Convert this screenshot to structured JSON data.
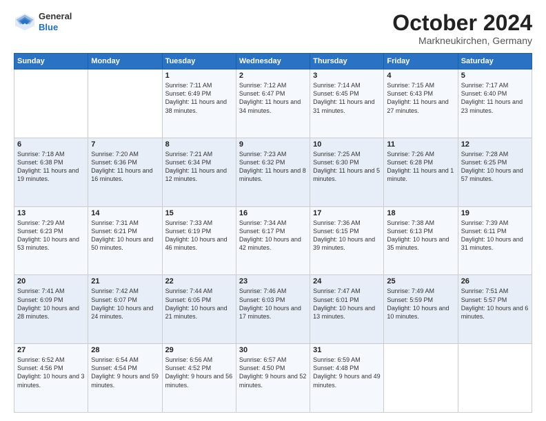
{
  "header": {
    "logo": {
      "general": "General",
      "blue": "Blue"
    },
    "title": "October 2024",
    "location": "Markneukirchen, Germany"
  },
  "weekdays": [
    "Sunday",
    "Monday",
    "Tuesday",
    "Wednesday",
    "Thursday",
    "Friday",
    "Saturday"
  ],
  "weeks": [
    [
      {
        "day": "",
        "info": ""
      },
      {
        "day": "",
        "info": ""
      },
      {
        "day": "1",
        "info": "Sunrise: 7:11 AM\nSunset: 6:49 PM\nDaylight: 11 hours and 38 minutes."
      },
      {
        "day": "2",
        "info": "Sunrise: 7:12 AM\nSunset: 6:47 PM\nDaylight: 11 hours and 34 minutes."
      },
      {
        "day": "3",
        "info": "Sunrise: 7:14 AM\nSunset: 6:45 PM\nDaylight: 11 hours and 31 minutes."
      },
      {
        "day": "4",
        "info": "Sunrise: 7:15 AM\nSunset: 6:43 PM\nDaylight: 11 hours and 27 minutes."
      },
      {
        "day": "5",
        "info": "Sunrise: 7:17 AM\nSunset: 6:40 PM\nDaylight: 11 hours and 23 minutes."
      }
    ],
    [
      {
        "day": "6",
        "info": "Sunrise: 7:18 AM\nSunset: 6:38 PM\nDaylight: 11 hours and 19 minutes."
      },
      {
        "day": "7",
        "info": "Sunrise: 7:20 AM\nSunset: 6:36 PM\nDaylight: 11 hours and 16 minutes."
      },
      {
        "day": "8",
        "info": "Sunrise: 7:21 AM\nSunset: 6:34 PM\nDaylight: 11 hours and 12 minutes."
      },
      {
        "day": "9",
        "info": "Sunrise: 7:23 AM\nSunset: 6:32 PM\nDaylight: 11 hours and 8 minutes."
      },
      {
        "day": "10",
        "info": "Sunrise: 7:25 AM\nSunset: 6:30 PM\nDaylight: 11 hours and 5 minutes."
      },
      {
        "day": "11",
        "info": "Sunrise: 7:26 AM\nSunset: 6:28 PM\nDaylight: 11 hours and 1 minute."
      },
      {
        "day": "12",
        "info": "Sunrise: 7:28 AM\nSunset: 6:25 PM\nDaylight: 10 hours and 57 minutes."
      }
    ],
    [
      {
        "day": "13",
        "info": "Sunrise: 7:29 AM\nSunset: 6:23 PM\nDaylight: 10 hours and 53 minutes."
      },
      {
        "day": "14",
        "info": "Sunrise: 7:31 AM\nSunset: 6:21 PM\nDaylight: 10 hours and 50 minutes."
      },
      {
        "day": "15",
        "info": "Sunrise: 7:33 AM\nSunset: 6:19 PM\nDaylight: 10 hours and 46 minutes."
      },
      {
        "day": "16",
        "info": "Sunrise: 7:34 AM\nSunset: 6:17 PM\nDaylight: 10 hours and 42 minutes."
      },
      {
        "day": "17",
        "info": "Sunrise: 7:36 AM\nSunset: 6:15 PM\nDaylight: 10 hours and 39 minutes."
      },
      {
        "day": "18",
        "info": "Sunrise: 7:38 AM\nSunset: 6:13 PM\nDaylight: 10 hours and 35 minutes."
      },
      {
        "day": "19",
        "info": "Sunrise: 7:39 AM\nSunset: 6:11 PM\nDaylight: 10 hours and 31 minutes."
      }
    ],
    [
      {
        "day": "20",
        "info": "Sunrise: 7:41 AM\nSunset: 6:09 PM\nDaylight: 10 hours and 28 minutes."
      },
      {
        "day": "21",
        "info": "Sunrise: 7:42 AM\nSunset: 6:07 PM\nDaylight: 10 hours and 24 minutes."
      },
      {
        "day": "22",
        "info": "Sunrise: 7:44 AM\nSunset: 6:05 PM\nDaylight: 10 hours and 21 minutes."
      },
      {
        "day": "23",
        "info": "Sunrise: 7:46 AM\nSunset: 6:03 PM\nDaylight: 10 hours and 17 minutes."
      },
      {
        "day": "24",
        "info": "Sunrise: 7:47 AM\nSunset: 6:01 PM\nDaylight: 10 hours and 13 minutes."
      },
      {
        "day": "25",
        "info": "Sunrise: 7:49 AM\nSunset: 5:59 PM\nDaylight: 10 hours and 10 minutes."
      },
      {
        "day": "26",
        "info": "Sunrise: 7:51 AM\nSunset: 5:57 PM\nDaylight: 10 hours and 6 minutes."
      }
    ],
    [
      {
        "day": "27",
        "info": "Sunrise: 6:52 AM\nSunset: 4:56 PM\nDaylight: 10 hours and 3 minutes."
      },
      {
        "day": "28",
        "info": "Sunrise: 6:54 AM\nSunset: 4:54 PM\nDaylight: 9 hours and 59 minutes."
      },
      {
        "day": "29",
        "info": "Sunrise: 6:56 AM\nSunset: 4:52 PM\nDaylight: 9 hours and 56 minutes."
      },
      {
        "day": "30",
        "info": "Sunrise: 6:57 AM\nSunset: 4:50 PM\nDaylight: 9 hours and 52 minutes."
      },
      {
        "day": "31",
        "info": "Sunrise: 6:59 AM\nSunset: 4:48 PM\nDaylight: 9 hours and 49 minutes."
      },
      {
        "day": "",
        "info": ""
      },
      {
        "day": "",
        "info": ""
      }
    ]
  ]
}
